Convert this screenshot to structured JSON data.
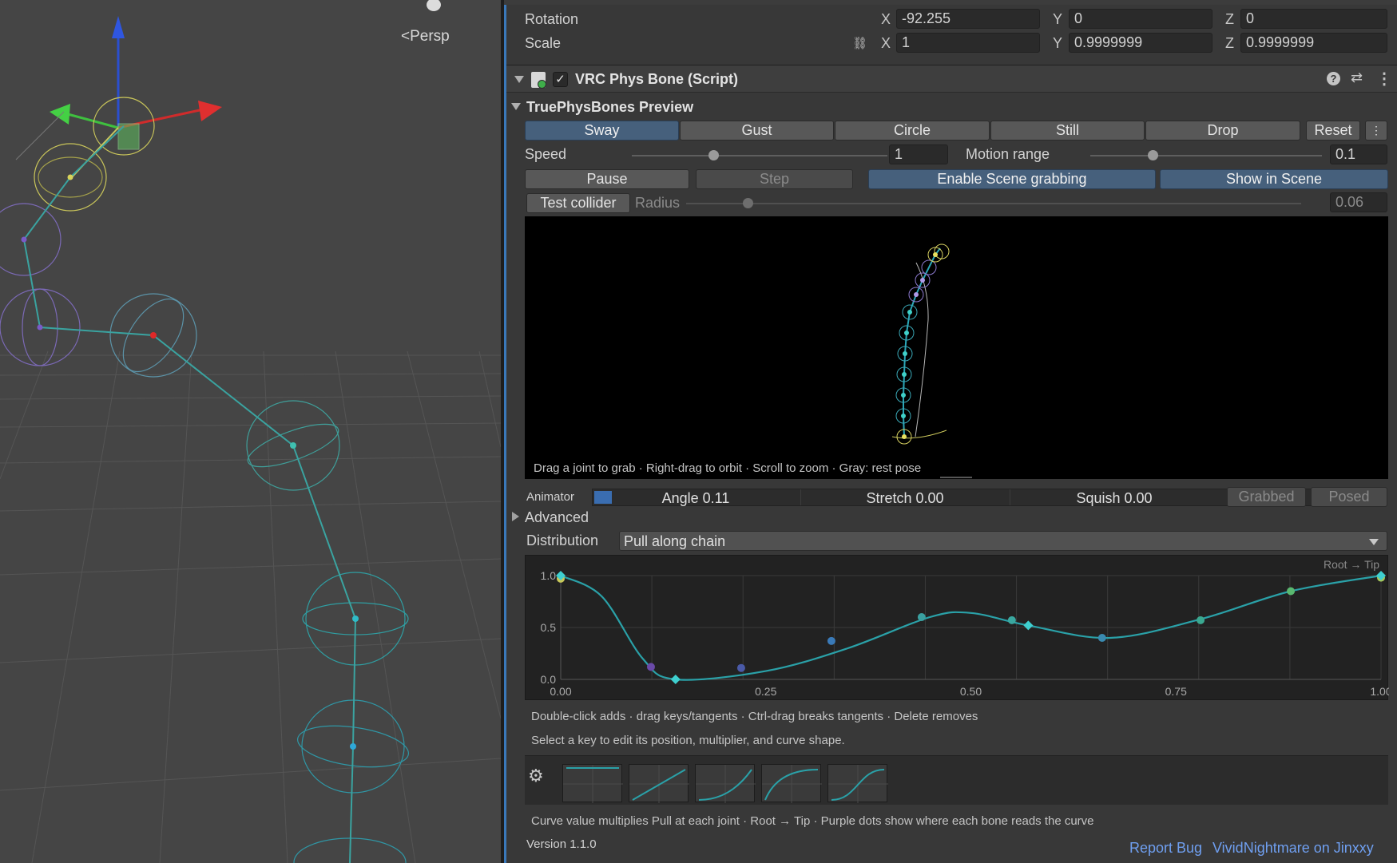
{
  "scene": {
    "view_label": "Persp"
  },
  "transform": {
    "rotation_label": "Rotation",
    "scale_label": "Scale",
    "rotation": {
      "x": "-92.255",
      "y": "0",
      "z": "0"
    },
    "scale": {
      "x": "1",
      "y": "0.9999999",
      "z": "0.9999999"
    },
    "axis_x": "X",
    "axis_y": "Y",
    "axis_z": "Z"
  },
  "component": {
    "title": "VRC Phys Bone (Script)",
    "icons": [
      "help-icon",
      "preset-icon",
      "kebab-menu-icon"
    ]
  },
  "preview": {
    "title": "TruePhysBones Preview",
    "modes": [
      "Sway",
      "Gust",
      "Circle",
      "Still",
      "Drop"
    ],
    "active_mode": "Sway",
    "reset_label": "Reset",
    "more_label": "⋮",
    "speed_label": "Speed",
    "speed_value": "1",
    "speed_level": 0.32,
    "motion_range_label": "Motion range",
    "motion_range_value": "0.1",
    "motion_range_level": 0.27,
    "pause_label": "Pause",
    "step_label": "Step",
    "grab_label": "Enable Scene grabbing",
    "show_label": "Show in Scene",
    "test_collider_label": "Test collider",
    "radius_label": "Radius",
    "radius_value": "0.06",
    "radius_level": 0.1,
    "viewport_hint": "Drag a joint to grab  ·  Right-drag to orbit  ·  Scroll to zoom  ·  Gray: rest pose"
  },
  "animator": {
    "label": "Animator",
    "angle": "Angle 0.11",
    "stretch": "Stretch 0.00",
    "squish": "Squish 0.00",
    "grabbed": "Grabbed",
    "posed": "Posed"
  },
  "advanced_label": "Advanced",
  "distribution": {
    "label": "Distribution",
    "value": "Pull along chain"
  },
  "curve": {
    "corner_label": "Root → Tip",
    "help1": "Double-click adds  ·  drag keys/tangents  ·  Ctrl-drag breaks tangents  ·  Delete removes",
    "help2": "Select a key to edit its position, multiplier, and curve shape.",
    "presets": [
      "flat",
      "linear",
      "ease-in",
      "ease-out",
      "ease-in-out"
    ],
    "footer": "Curve value multiplies Pull at each joint  ·  Root → Tip  ·  Purple dots show where each bone reads the curve"
  },
  "chart_data": {
    "type": "line",
    "title": "",
    "xlabel": "",
    "ylabel": "",
    "xlim": [
      0,
      1
    ],
    "ylim": [
      0,
      1
    ],
    "x_ticks": [
      "0.00",
      "0.25",
      "0.50",
      "0.75",
      "1.00"
    ],
    "y_ticks": [
      "0.0",
      "0.5",
      "1.0"
    ],
    "grid": true,
    "series": [
      {
        "keys": [
          {
            "x": 0.0,
            "y": 1.0
          },
          {
            "x": 0.14,
            "y": 0.0
          },
          {
            "x": 0.57,
            "y": 0.52
          },
          {
            "x": 1.0,
            "y": 1.0
          }
        ],
        "curve": [
          {
            "x": 0.0,
            "y": 1.0
          },
          {
            "x": 0.05,
            "y": 0.8
          },
          {
            "x": 0.1,
            "y": 0.2
          },
          {
            "x": 0.14,
            "y": 0.0
          },
          {
            "x": 0.25,
            "y": 0.08
          },
          {
            "x": 0.35,
            "y": 0.3
          },
          {
            "x": 0.45,
            "y": 0.6
          },
          {
            "x": 0.5,
            "y": 0.64
          },
          {
            "x": 0.57,
            "y": 0.52
          },
          {
            "x": 0.67,
            "y": 0.4
          },
          {
            "x": 0.78,
            "y": 0.58
          },
          {
            "x": 0.89,
            "y": 0.85
          },
          {
            "x": 1.0,
            "y": 1.0
          }
        ],
        "samples": [
          {
            "x": 0.0,
            "y": 0.97
          },
          {
            "x": 0.11,
            "y": 0.12
          },
          {
            "x": 0.22,
            "y": 0.11
          },
          {
            "x": 0.33,
            "y": 0.37
          },
          {
            "x": 0.44,
            "y": 0.6
          },
          {
            "x": 0.55,
            "y": 0.57
          },
          {
            "x": 0.66,
            "y": 0.4
          },
          {
            "x": 0.78,
            "y": 0.57
          },
          {
            "x": 0.89,
            "y": 0.85
          },
          {
            "x": 1.0,
            "y": 0.98
          }
        ]
      }
    ]
  },
  "footer": {
    "version": "Version 1.1.0",
    "report_bug": "Report Bug",
    "author_link": "VividNightmare on Jinxxy"
  }
}
